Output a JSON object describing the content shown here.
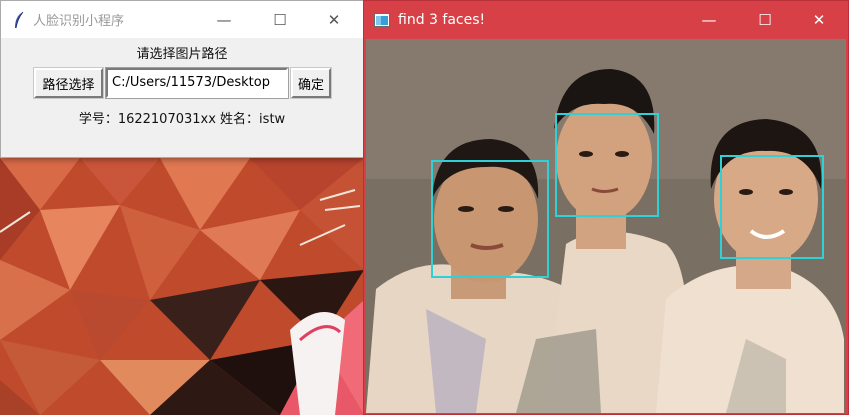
{
  "dialog": {
    "title": "人脸识别小程序",
    "prompt": "请选择图片路径",
    "browse_label": "路径选择",
    "path_value": "C:/Users/11573/Desktop",
    "confirm_label": "确定",
    "info": "学号：1622107031xx 姓名：istw",
    "controls": {
      "minimize": "—",
      "maximize": "☐",
      "close": "✕"
    }
  },
  "result_window": {
    "title": "find 3 faces!",
    "controls": {
      "minimize": "—",
      "maximize": "☐",
      "close": "✕"
    },
    "detections": 3,
    "box_color": "#2fd1d6"
  },
  "colors": {
    "result_titlebar": "#d84047",
    "dialog_bg": "#f0f0f0",
    "wallpaper_accent": "#d8603a"
  }
}
